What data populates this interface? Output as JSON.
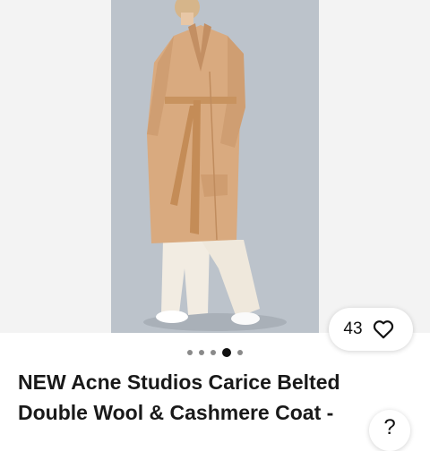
{
  "listing": {
    "title": "NEW Acne Studios Carice Belted Double Wool & Cashmere Coat -",
    "like_count": "43",
    "gallery": {
      "image_count": 5,
      "active_index": 3
    },
    "share_glyph": "?"
  },
  "icons": {
    "like": "heart-outline-icon"
  },
  "colors": {
    "photo_bg": "#bcc3cb",
    "coat": "#d9aa7f",
    "text": "#191919"
  }
}
